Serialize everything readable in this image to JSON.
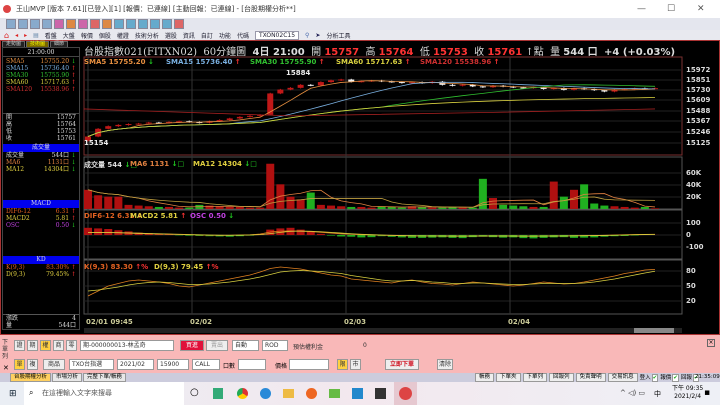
{
  "window": {
    "title": "王山MVP [版本 7.61][已登入][1] [報價：已連線] [主動回報：已連線] - [台股期權分析**]",
    "minimize": "—",
    "maximize": "☐",
    "close": "✕"
  },
  "menu": {
    "items": [
      "看盤",
      "大盤",
      "報價",
      "個股",
      "權證",
      "技術分析",
      "選股",
      "資訊",
      "自訂",
      "功能"
    ],
    "code_label": "代碼",
    "code_value": "TXON02C15",
    "tools": "分析工具"
  },
  "tabs": [
    "走勢圖",
    "技術圖",
    "細節"
  ],
  "left_panel": {
    "time": "21:00:00",
    "sma": [
      {
        "label": "SMA5",
        "value": "15755.20",
        "dir": "down",
        "color": "#e89040"
      },
      {
        "label": "SMA15",
        "value": "15736.40",
        "dir": "up",
        "color": "#7ab0e0"
      },
      {
        "label": "SMA30",
        "value": "15755.90",
        "dir": "up",
        "color": "#30c030"
      },
      {
        "label": "SMA60",
        "value": "15717.63",
        "dir": "up",
        "color": "#d8d040"
      },
      {
        "label": "SMA120",
        "value": "15538.96",
        "dir": "up",
        "color": "#d03030"
      }
    ],
    "ohlc": [
      {
        "label": "開",
        "value": "15757"
      },
      {
        "label": "高",
        "value": "15764"
      },
      {
        "label": "低",
        "value": "15753"
      },
      {
        "label": "收",
        "value": "15761"
      }
    ],
    "volume_header": "成交量",
    "volume": [
      {
        "label": "成交量",
        "value": "544口",
        "dir": "down",
        "color": "#ddd"
      },
      {
        "label": "MA6",
        "value": "1131口",
        "dir": "down",
        "color": "#e08040"
      },
      {
        "label": "MA12",
        "value": "14304口",
        "dir": "down",
        "color": "#e0d040"
      }
    ],
    "macd_header": "MACD",
    "macd": [
      {
        "label": "DIF6-12",
        "value": "6.31",
        "dir": "up",
        "color": "#e06020"
      },
      {
        "label": "MACD2",
        "value": "5.81",
        "dir": "up",
        "color": "#e0d040"
      },
      {
        "label": "OSC",
        "value": "0.50",
        "dir": "down",
        "color": "#c040e0"
      }
    ],
    "kd_header": "KD",
    "kd": [
      {
        "label": "K(9,3)",
        "value": "83.30%",
        "dir": "up",
        "color": "#e06020"
      },
      {
        "label": "D(9,3)",
        "value": "79.45%",
        "dir": "up",
        "color": "#e0d040"
      }
    ],
    "change_label": "漲跌",
    "change_value": "4",
    "vol_label": "量",
    "vol_value": "544口"
  },
  "chart_header": {
    "name": "台股指數021(FITXN02)",
    "period": "60分鐘圖",
    "date": "4日 21:00",
    "open_label": "開",
    "open": "15757",
    "high_label": "高",
    "high": "15764",
    "low_label": "低",
    "low": "15753",
    "close_label": "收",
    "close": "15761",
    "unit": "↑點",
    "vol_label": "量",
    "vol": "544 口",
    "change": "+4 (+0.03%)"
  },
  "legends": {
    "price": [
      {
        "text": "SMA5 15755.20",
        "arrow": "↓",
        "color": "#e89040"
      },
      {
        "text": "SMA15 15736.40",
        "arrow": "↑",
        "color": "#7ab0e0"
      },
      {
        "text": "SMA30 15755.90",
        "arrow": "↑",
        "color": "#30c030"
      },
      {
        "text": "SMA60 15717.63",
        "arrow": "↑",
        "color": "#d8d040"
      },
      {
        "text": "SMA120 15538.96",
        "arrow": "↑",
        "color": "#d03030"
      }
    ],
    "volume": [
      {
        "text": "成交量 544",
        "arrow": "↓□",
        "color": "#ddd"
      },
      {
        "text": "MA6 1131",
        "arrow": "↓□",
        "color": "#e08040"
      },
      {
        "text": "MA12 14304",
        "arrow": "↓□",
        "color": "#e0d040"
      }
    ],
    "macd": [
      {
        "text": "DIF6-12 6.31",
        "arrow": "↑",
        "color": "#e06020"
      },
      {
        "text": "MACD2 5.81",
        "arrow": "↑",
        "color": "#e0d040"
      },
      {
        "text": "OSC 0.50",
        "arrow": "↓",
        "color": "#c040e0"
      }
    ],
    "kd": [
      {
        "text": "K(9,3) 83.30",
        "arrow": "↑%",
        "color": "#e06020"
      },
      {
        "text": "D(9,3) 79.45",
        "arrow": "↑%",
        "color": "#e0d040"
      }
    ]
  },
  "axes": {
    "price": [
      "15972",
      "15851",
      "15730",
      "15609",
      "15488",
      "15367",
      "15246",
      "15125"
    ],
    "volume": [
      "60K",
      "40K",
      "20K"
    ],
    "macd": [
      "100",
      "0",
      "-100"
    ],
    "kd": [
      "80",
      "50",
      "20"
    ],
    "dates": [
      "02/01 09:45",
      "02/02",
      "02/03",
      "02/04"
    ],
    "high_mark": "15884",
    "low_mark": "15154"
  },
  "chart": {
    "closes": [
      15200,
      15290,
      15320,
      15335,
      15345,
      15350,
      15362,
      15358,
      15370,
      15378,
      15368,
      15360,
      15378,
      15392,
      15410,
      15428,
      15440,
      15452,
      15700,
      15745,
      15765,
      15800,
      15792,
      15832,
      15852,
      15862,
      15835,
      15842,
      15850,
      15840,
      15832,
      15822,
      15830,
      15820,
      15836,
      15800,
      15790,
      15802,
      15782,
      15772,
      15790,
      15780,
      15770,
      15762,
      15772,
      15752,
      15762,
      15742,
      15760,
      15750,
      15738,
      15722,
      15742,
      15750,
      15760,
      15757,
      15761
    ],
    "volume": [
      28,
      20,
      18,
      18,
      6,
      5,
      4,
      3,
      3,
      2,
      2,
      6,
      5,
      4,
      3,
      3,
      2,
      2,
      66,
      36,
      18,
      14,
      24,
      6,
      5,
      4,
      3,
      3,
      2,
      4,
      3,
      2,
      4,
      3,
      2,
      2,
      3,
      2,
      2,
      44,
      16,
      6,
      5,
      4,
      3,
      3,
      40,
      18,
      28,
      36,
      8,
      5,
      4,
      3,
      2,
      3,
      1
    ],
    "osc": [
      60,
      55,
      50,
      40,
      30,
      20,
      15,
      10,
      5,
      -3,
      -6,
      -8,
      -10,
      -12,
      -14,
      -10,
      -5,
      8,
      45,
      55,
      60,
      45,
      30,
      10,
      -5,
      -12,
      -14,
      -20,
      -18,
      -10,
      -15,
      -20,
      -24,
      -24,
      -22,
      -20,
      -24,
      -26,
      -18,
      -14,
      -18,
      -22,
      -20,
      -26,
      -28,
      -24,
      -20,
      -18,
      -24,
      -22,
      -20,
      -14,
      -10,
      -8,
      -4,
      2,
      1
    ],
    "k": [
      30,
      40,
      50,
      55,
      60,
      62,
      60,
      58,
      55,
      50,
      48,
      52,
      56,
      60,
      64,
      68,
      72,
      78,
      85,
      88,
      86,
      84,
      80,
      76,
      72,
      70,
      64,
      62,
      60,
      58,
      56,
      60,
      62,
      58,
      55,
      54,
      52,
      55,
      58,
      56,
      54,
      52,
      50,
      52,
      55,
      58,
      56,
      54,
      55,
      58,
      62,
      66,
      70,
      75,
      78,
      82,
      83.3
    ],
    "d": [
      40,
      42,
      45,
      48,
      52,
      55,
      57,
      58,
      57,
      55,
      53,
      53,
      54,
      56,
      58,
      61,
      64,
      68,
      73,
      78,
      80,
      81,
      80,
      79,
      77,
      75,
      71,
      68,
      65,
      62,
      60,
      60,
      61,
      60,
      58,
      57,
      55,
      55,
      56,
      56,
      55,
      54,
      53,
      53,
      54,
      55,
      55,
      55,
      55,
      56,
      58,
      61,
      64,
      68,
      72,
      76,
      79.45
    ],
    "dif": [
      20,
      22,
      20,
      18,
      15,
      12,
      10,
      8,
      6,
      4,
      2,
      0,
      -2,
      -3,
      -2,
      0,
      2,
      8,
      25,
      32,
      34,
      32,
      28,
      22,
      16,
      10,
      6,
      2,
      0,
      -2,
      -4,
      -6,
      -8,
      -8,
      -8,
      -9,
      -10,
      -10,
      -9,
      -8,
      -8,
      -9,
      -9,
      -10,
      -10,
      -9,
      -8,
      -7,
      -6,
      -5,
      -4,
      -2,
      0,
      2,
      4,
      5,
      6.31
    ],
    "up_color": "#c01818",
    "down_color": "#f0f0f0",
    "vol_up": "#b01010",
    "vol_down": "#20b020"
  },
  "order": {
    "acct_types": [
      "證",
      "期",
      "權",
      "商",
      "零"
    ],
    "account": "期-000000013-林孟奇",
    "buy": "買進",
    "sell": "賣出",
    "mode": "自動",
    "cond": "ROD",
    "margin_label": "預估權利金",
    "margin_value": "0",
    "row2": [
      "單",
      "複"
    ],
    "product_btn": "商品",
    "product": "TXO台指選",
    "month": "2021/02",
    "strike": "15900",
    "cp": "CALL",
    "qty_label": "口數",
    "price_label": "價格",
    "limit": "限",
    "market": "市",
    "submit": "立即下單",
    "clear": "清除",
    "side_title": "下單列"
  },
  "status_tabs": [
    "台股期權分析",
    "市場分析",
    "完整下單/帳務"
  ],
  "status_buttons": [
    "帳務",
    "下單夾",
    "下單列",
    "回報列",
    "免責聲明",
    "交易訊息"
  ],
  "status_flags": [
    {
      "label": "登入"
    },
    {
      "label": "報價"
    },
    {
      "label": "回報"
    }
  ],
  "status_time": "21:35:09",
  "taskbar": {
    "search_placeholder": "在這裡輸入文字來搜尋",
    "time": "下午 09:35",
    "date": "2021/2/4",
    "ime": "中"
  }
}
